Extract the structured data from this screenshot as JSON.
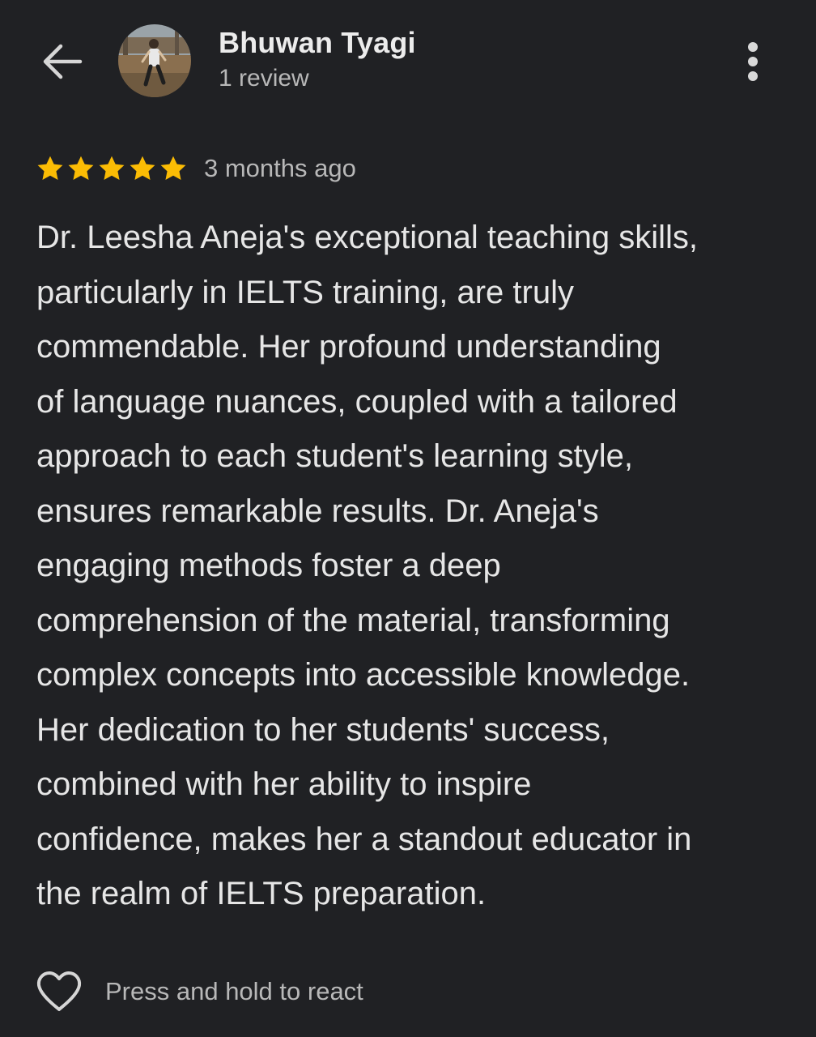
{
  "header": {
    "back_icon": "arrow-left-icon",
    "reviewer_name": "Bhuwan Tyagi",
    "review_count": "1 review",
    "more_icon": "more-vertical-icon"
  },
  "review": {
    "rating": 5,
    "rating_max": 5,
    "star_icon": "star-icon",
    "star_color": "#fbbc04",
    "date": "3 months ago",
    "lines": [
      "Dr. Leesha Aneja's exceptional teaching skills,",
      "particularly in IELTS training, are truly",
      "commendable. Her profound understanding",
      "of language nuances, coupled with a tailored",
      "approach to each student's learning style,",
      "ensures remarkable results. Dr. Aneja's",
      "engaging methods foster a deep",
      "comprehension of the material, transforming",
      "complex concepts into accessible knowledge.",
      "Her dedication to her students' success,",
      "combined with her ability to inspire",
      "confidence, makes her a standout educator in",
      "the realm of IELTS preparation."
    ]
  },
  "footer": {
    "heart_icon": "heart-outline-icon",
    "react_label": "Press and hold to react"
  },
  "colors": {
    "background": "#202124",
    "primary_text": "#e6e6e6",
    "secondary_text": "#b8b8b8"
  }
}
